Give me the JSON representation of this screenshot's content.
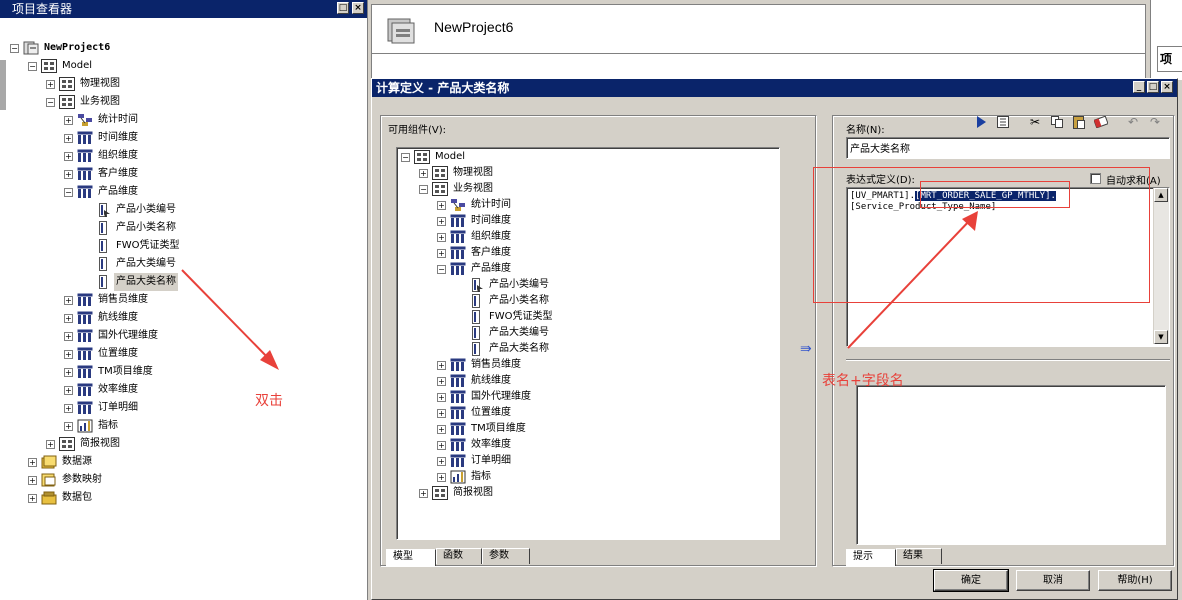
{
  "explorer": {
    "title": "项目查看器",
    "tree": [
      {
        "label": "NewProject6",
        "icon": "project-icon",
        "expander": "-",
        "bold": true
      },
      {
        "label": "Model",
        "icon": "folder-model-icon",
        "expander": "-"
      },
      {
        "label": "物理视图",
        "icon": "view-icon",
        "expander": "+"
      },
      {
        "label": "业务视图",
        "icon": "view-icon",
        "expander": "-"
      },
      {
        "label": "统计时间",
        "icon": "hierarchy-icon",
        "expander": "+"
      },
      {
        "label": "时间维度",
        "icon": "dimension-icon",
        "expander": "+"
      },
      {
        "label": "组织维度",
        "icon": "dimension-icon",
        "expander": "+"
      },
      {
        "label": "客户维度",
        "icon": "dimension-icon",
        "expander": "+"
      },
      {
        "label": "产品维度",
        "icon": "dimension-icon",
        "expander": "-"
      },
      {
        "label": "产品小类编号",
        "icon": "attribute-key-icon",
        "expander": ""
      },
      {
        "label": "产品小类名称",
        "icon": "attribute-icon",
        "expander": ""
      },
      {
        "label": "FWO凭证类型",
        "icon": "attribute-icon",
        "expander": ""
      },
      {
        "label": "产品大类编号",
        "icon": "attribute-icon",
        "expander": ""
      },
      {
        "label": "产品大类名称",
        "icon": "attribute-icon",
        "expander": "",
        "selected": true
      },
      {
        "label": "销售员维度",
        "icon": "dimension-icon",
        "expander": "+"
      },
      {
        "label": "航线维度",
        "icon": "dimension-icon",
        "expander": "+"
      },
      {
        "label": "国外代理维度",
        "icon": "dimension-icon",
        "expander": "+"
      },
      {
        "label": "位置维度",
        "icon": "dimension-icon",
        "expander": "+"
      },
      {
        "label": "TM项目维度",
        "icon": "dimension-icon",
        "expander": "+"
      },
      {
        "label": "效率维度",
        "icon": "dimension-icon",
        "expander": "+"
      },
      {
        "label": "订单明细",
        "icon": "dimension-icon",
        "expander": "+"
      },
      {
        "label": "指标",
        "icon": "measure-icon",
        "expander": "+"
      },
      {
        "label": "简报视图",
        "icon": "view-icon",
        "expander": "+"
      },
      {
        "label": "数据源",
        "icon": "datasource-icon",
        "expander": "+"
      },
      {
        "label": "参数映射",
        "icon": "parameter-icon",
        "expander": "+"
      },
      {
        "label": "数据包",
        "icon": "package-icon",
        "expander": "+"
      }
    ]
  },
  "background": {
    "project_title": "NewProject6",
    "side_tab_label": "项目"
  },
  "dialog": {
    "title": "计算定义 - 产品大类名称",
    "available_components_label": "可用组件(V):",
    "name_label": "名称(N):",
    "name_value": "产品大类名称",
    "expression_label": "表达式定义(D):",
    "auto_sum_label": "自动求和(A)",
    "expression_part1": "[UV_PMART1].",
    "expression_part2": "[MRT_ORDER_SALE_GP_MTHLY].",
    "expression_part3": "[Service_Product_Type_Name]",
    "insert_arrow": "⇛",
    "component_tree": [
      {
        "label": "Model",
        "icon": "folder-model-icon",
        "expander": "-"
      },
      {
        "label": "物理视图",
        "icon": "view-icon",
        "expander": "+"
      },
      {
        "label": "业务视图",
        "icon": "view-icon",
        "expander": "-"
      },
      {
        "label": "统计时间",
        "icon": "hierarchy-icon",
        "expander": "+"
      },
      {
        "label": "时间维度",
        "icon": "dimension-icon",
        "expander": "+"
      },
      {
        "label": "组织维度",
        "icon": "dimension-icon",
        "expander": "+"
      },
      {
        "label": "客户维度",
        "icon": "dimension-icon",
        "expander": "+"
      },
      {
        "label": "产品维度",
        "icon": "dimension-icon",
        "expander": "-"
      },
      {
        "label": "产品小类编号",
        "icon": "attribute-key-icon",
        "expander": ""
      },
      {
        "label": "产品小类名称",
        "icon": "attribute-icon",
        "expander": ""
      },
      {
        "label": "FWO凭证类型",
        "icon": "attribute-icon",
        "expander": ""
      },
      {
        "label": "产品大类编号",
        "icon": "attribute-icon",
        "expander": ""
      },
      {
        "label": "产品大类名称",
        "icon": "attribute-icon",
        "expander": ""
      },
      {
        "label": "销售员维度",
        "icon": "dimension-icon",
        "expander": "+"
      },
      {
        "label": "航线维度",
        "icon": "dimension-icon",
        "expander": "+"
      },
      {
        "label": "国外代理维度",
        "icon": "dimension-icon",
        "expander": "+"
      },
      {
        "label": "位置维度",
        "icon": "dimension-icon",
        "expander": "+"
      },
      {
        "label": "TM项目维度",
        "icon": "dimension-icon",
        "expander": "+"
      },
      {
        "label": "效率维度",
        "icon": "dimension-icon",
        "expander": "+"
      },
      {
        "label": "订单明细",
        "icon": "dimension-icon",
        "expander": "+"
      },
      {
        "label": "指标",
        "icon": "measure-icon",
        "expander": "+"
      },
      {
        "label": "简报视图",
        "icon": "view-icon",
        "expander": "+"
      }
    ],
    "left_tabs": [
      "模型",
      "函数",
      "参数"
    ],
    "right_tabs": [
      "提示",
      "结果"
    ],
    "buttons": {
      "ok": "确定",
      "cancel": "取消",
      "help": "帮助(H)"
    }
  },
  "annotations": {
    "double_click": "双击",
    "table_field": "表名+字段名",
    "color": "#e8413a"
  }
}
